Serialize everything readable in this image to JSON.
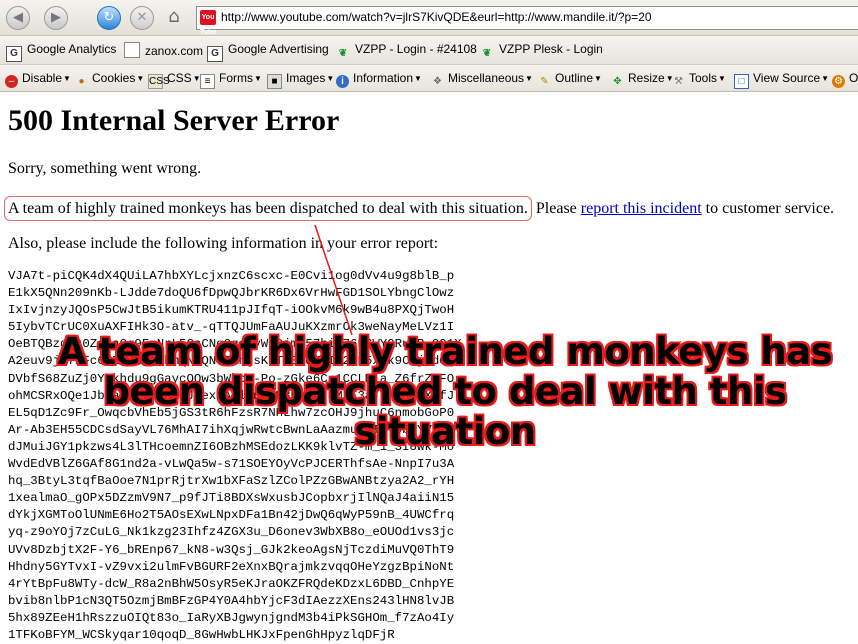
{
  "nav": {
    "back_icon": "back-arrow-icon",
    "forward_icon": "forward-arrow-icon",
    "reload_icon": "reload-icon",
    "stop_icon": "stop-icon",
    "home_icon": "home-icon",
    "favicon_text": "You Tube",
    "url": "http://www.youtube.com/watch?v=jlrS7KivQDE&eurl=http://www.mandile.it/?p=20"
  },
  "bookmarks": [
    {
      "label": "Google Analytics",
      "icon": "google-icon"
    },
    {
      "label": "zanox.com",
      "icon": "page-icon"
    },
    {
      "label": "Google Advertising",
      "icon": "google-icon"
    },
    {
      "label": "VZPP - Login - #24108",
      "icon": "vzpp-icon"
    },
    {
      "label": "VZPP Plesk - Login",
      "icon": "vzpp-icon"
    }
  ],
  "devbar": [
    {
      "label": "Disable",
      "icon": "disable-icon"
    },
    {
      "label": "Cookies",
      "icon": "cookies-icon"
    },
    {
      "label": "CSS",
      "icon": "css-icon"
    },
    {
      "label": "Forms",
      "icon": "forms-icon"
    },
    {
      "label": "Images",
      "icon": "images-icon"
    },
    {
      "label": "Information",
      "icon": "information-icon"
    },
    {
      "label": "Miscellaneous",
      "icon": "miscellaneous-icon"
    },
    {
      "label": "Outline",
      "icon": "outline-icon"
    },
    {
      "label": "Resize",
      "icon": "resize-icon"
    },
    {
      "label": "Tools",
      "icon": "tools-icon"
    },
    {
      "label": "View Source",
      "icon": "view-source-icon"
    },
    {
      "label": "O",
      "icon": "options-icon"
    }
  ],
  "page": {
    "title": "500 Internal Server Error",
    "sorry": "Sorry, something went wrong.",
    "monkeys": "A team of highly trained monkeys has been dispatched to deal with this situation.",
    "please": " Please ",
    "report_link": "report this incident",
    "to_customer": " to customer service.",
    "also": "Also, please include the following information in your error report:",
    "code_lines": [
      "VJA7t-piCQK4dX4QUiLA7hbXYLcjxnzC6scxc-E0Cvi1og0dVv4u9g8blB_p",
      "E1kX5QNn209nKb-LJdde7doQU6fDpwQJbrKR6Dx6VrHwFGD1SOLYbngClOwz",
      "IxIvjnzyJQOsP5CwJtB5ikumKTRU411pJIfqT-iOOkvM6k9wB4u8PXQjTwoH",
      "5IybvTCrUC0XuAXFIHk3O-atv_-qTTQJUmFaAUJuKXzmrOk3weNayMeLVz1I",
      "OeBTQBzdZz0ZaSaGg9FmNrL5CaCNg0gshvWa9jmU57hiZ76KSWY9RuAB_Q91X",
      "A2euv9ji71Fc6OZcvw_f1bmQNcQNCEAhgsKUTs31QKcIW2fD5xMk9C4jtdOA",
      "DVbfS68ZuZj0Ynkhdu9gGaycOQw3bWbcT-Po-zGke6C-1CCLM1a_Z6frZeFO",
      "ohMCSRxOQe1JbiaXf7r0VeAdJMexhAHlkn73M8KgK7j3M1E3a-UKeRrnX9fJ",
      "EL5qD1Zc9Fr_OwqcbVhEb5jGS3tR6hFzsR7NHLhw7zcOHJ9jhuC6nmobGoP0",
      "Ar-Ab3EH55CDCsdSayVL76MhAI7ihXqjwRwtcBwnLaAazmu_ZTPYobJYVijm",
      "dJMuiJGY1pkzws4L3lTHcoemnZI6OBzhMSEdozLKK9klvTZ-m_1_3I8wk-Mo",
      "WvdEdVBlZ6GAf8G1nd2a-vLwQa5w-s71SOEYOyVcPJCERThfsAe-NnpI7u3A",
      "hq_3BtyL3tqfBaOoe7N1prRjtrXw1bXFaSzlZColPZzGBwANBtzya2A2_rYH",
      "1xealmaO_gOPx5DZzmV9N7_p9fJTi8BDXsWxusbJCopbxrjIlNQaJ4aiiN15",
      "dYkjXGMToOlUNmE6Ho2T5AOsEXwLNpxDFa1Bn42jDwQ6qWyP59nB_4UWCfrq",
      "yq-z9oYOj7zCuLG_Nk1kzg23Ihfz4ZGX3u_D6onev3WbXB8o_eOUOd1vs3jc",
      "UVv8DzbjtX2F-Y6_bREnp67_kN8-w3Qsj_GJk2keoAgsNjTczdiMuVQ0ThT9",
      "Hhdny5GYTvxI-vZ9vxi2ulmFvBGURF2eXnxBQrajmkzvqqOHeYzgzBpiNoNt",
      "4rYtBpFu8WTy-dcW_R8a2nBhW5OsyR5eKJraOKZFRQdeKDzxL6DBD_CnhpYE",
      "bvib8nlbP1cN3QT5OzmjBmBFzGP4Y0A4hbYjcF3dIAezzXEns243lHN8lvJB",
      "5hx89ZEeH1hRszzuOIQt83o_IaRyXBJgwynjgndM3b4iPkSGHOm_f7zAo4Iy",
      "1TFKoBFYM_WCSkyqar10qoqD_8GwHwbLHKJxFpenGhHpyzlqDFjR"
    ],
    "overlay_line1": "A team of highly trained monkeys has",
    "overlay_line2": "been dispatched to deal with this situation"
  },
  "colors": {
    "annotation_red": "#e81a1a",
    "link_blue": "#0000cc"
  }
}
